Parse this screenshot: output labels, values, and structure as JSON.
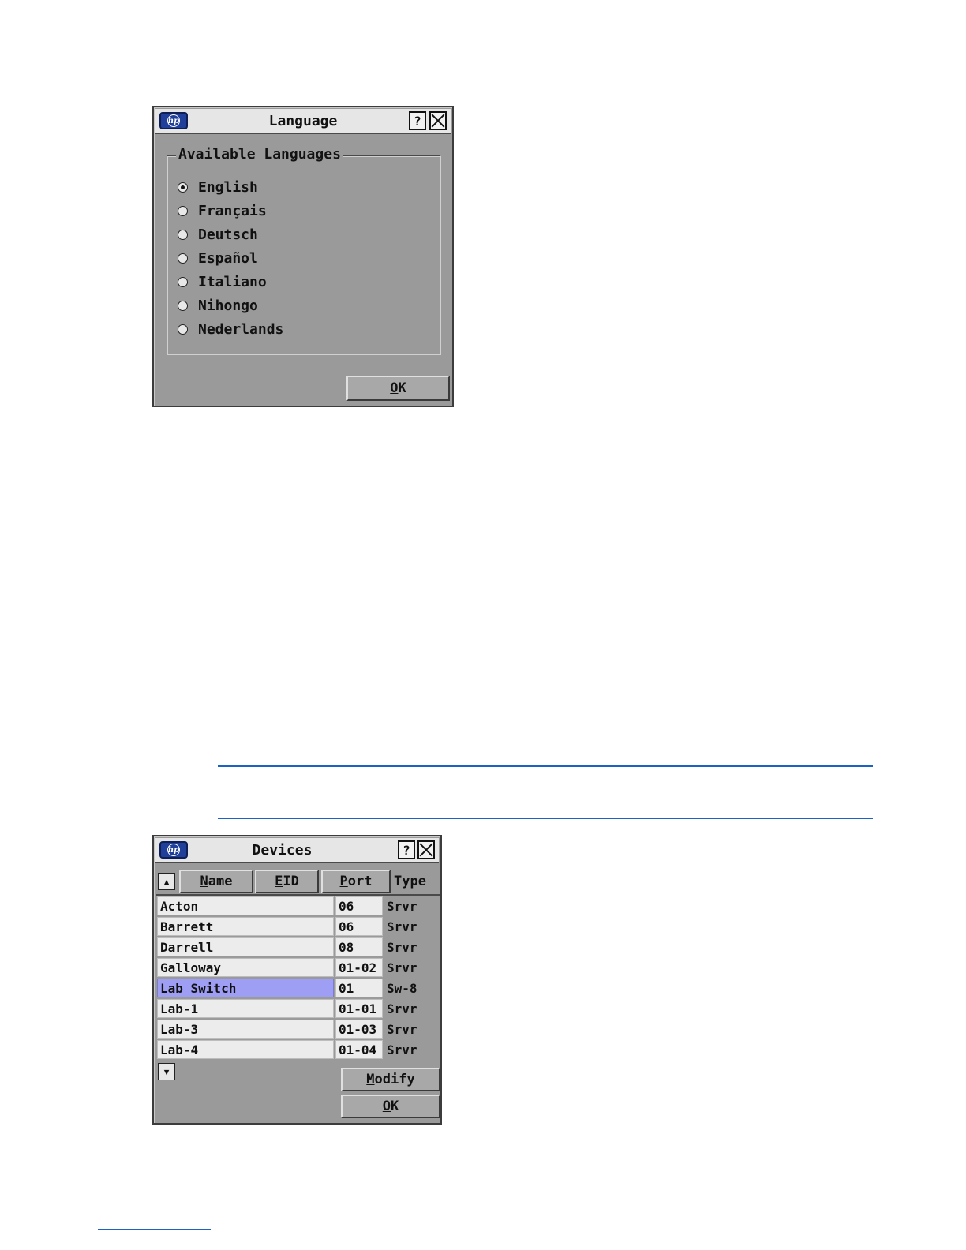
{
  "language_dialog": {
    "title": "Language",
    "help_label": "?",
    "group_label": "Available Languages",
    "languages": [
      {
        "label": "English",
        "selected": true
      },
      {
        "label": "Français",
        "selected": false
      },
      {
        "label": "Deutsch",
        "selected": false
      },
      {
        "label": "Español",
        "selected": false
      },
      {
        "label": "Italiano",
        "selected": false
      },
      {
        "label": "Nihongo",
        "selected": false
      },
      {
        "label": "Nederlands",
        "selected": false
      }
    ],
    "ok": {
      "accel": "O",
      "rest": "K"
    }
  },
  "devices_dialog": {
    "title": "Devices",
    "help_label": "?",
    "columns": {
      "name": {
        "accel": "N",
        "rest": "ame"
      },
      "eid": {
        "accel": "E",
        "rest": "ID"
      },
      "port": {
        "accel": "P",
        "rest": "ort"
      },
      "type": "Type"
    },
    "rows": [
      {
        "name": "Acton",
        "eid": "06",
        "type": "Srvr",
        "selected": false
      },
      {
        "name": "Barrett",
        "eid": "06",
        "type": "Srvr",
        "selected": false
      },
      {
        "name": "Darrell",
        "eid": "08",
        "type": "Srvr",
        "selected": false
      },
      {
        "name": "Galloway",
        "eid": "01-02",
        "type": "Srvr",
        "selected": false
      },
      {
        "name": "Lab Switch",
        "eid": "01",
        "type": "Sw-8",
        "selected": true
      },
      {
        "name": "Lab-1",
        "eid": "01-01",
        "type": "Srvr",
        "selected": false
      },
      {
        "name": "Lab-3",
        "eid": "01-03",
        "type": "Srvr",
        "selected": false
      },
      {
        "name": "Lab-4",
        "eid": "01-04",
        "type": "Srvr",
        "selected": false
      }
    ],
    "modify": {
      "accel": "M",
      "rest": "odify"
    },
    "ok": {
      "accel": "O",
      "rest": "K"
    }
  },
  "colors": {
    "dialog_bg": "#9a9a9a",
    "selection": "#9e9ef5",
    "rule": "#1a62c4",
    "hp_logo": "#1f3f9a"
  }
}
